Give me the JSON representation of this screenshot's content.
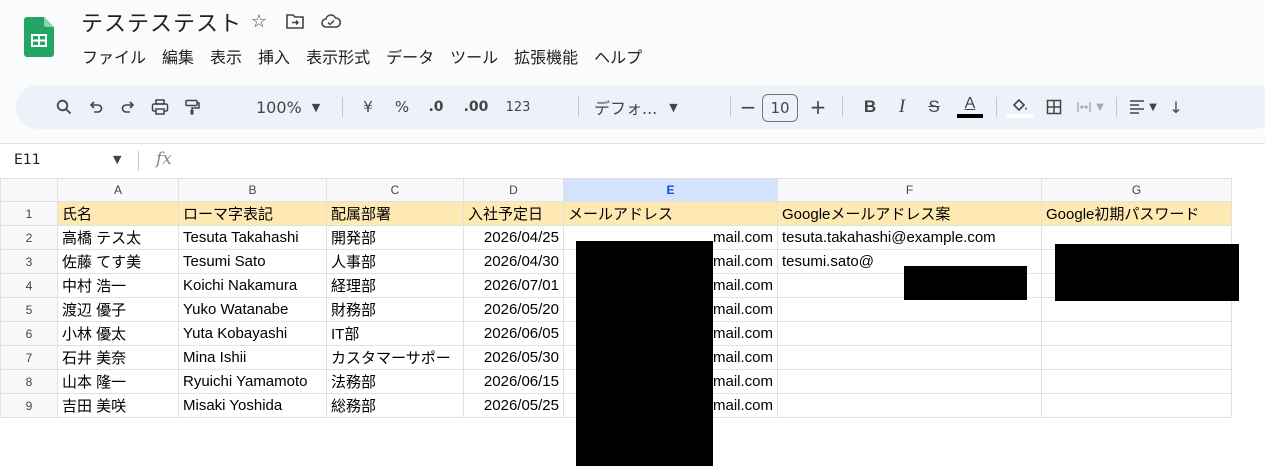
{
  "app": {
    "title": "テステステスト",
    "menu": [
      "ファイル",
      "編集",
      "表示",
      "挿入",
      "表示形式",
      "データ",
      "ツール",
      "拡張機能",
      "ヘルプ"
    ]
  },
  "toolbar": {
    "zoom": "100%",
    "currency": "¥",
    "percent": "%",
    "dec_decrease": ".0",
    "dec_increase": ".00",
    "number_format": "123",
    "font": "デフォ...",
    "minus": "−",
    "font_size": "10",
    "plus": "+",
    "bold": "B",
    "italic": "I",
    "strike": "S",
    "text_color": "A"
  },
  "formula_bar": {
    "cell_ref": "E11",
    "fx": "fx"
  },
  "columns": [
    "A",
    "B",
    "C",
    "D",
    "E",
    "F",
    "G"
  ],
  "selected_column": "E",
  "rows": [
    {
      "n": "1",
      "cells": [
        "氏名",
        "ローマ字表記",
        "配属部署",
        "入社予定日",
        "メールアドレス",
        "Googleメールアドレス案",
        "Google初期パスワード"
      ]
    },
    {
      "n": "2",
      "cells": [
        "高橋 テス太",
        "Tesuta Takahashi",
        "開発部",
        "2026/04/25",
        "mail.com",
        "tesuta.takahashi@example.com",
        ""
      ]
    },
    {
      "n": "3",
      "cells": [
        "佐藤 てす美",
        "Tesumi Sato",
        "人事部",
        "2026/04/30",
        "mail.com",
        "tesumi.sato@",
        ""
      ]
    },
    {
      "n": "4",
      "cells": [
        "中村 浩一",
        "Koichi Nakamura",
        "経理部",
        "2026/07/01",
        "mail.com",
        "",
        ""
      ]
    },
    {
      "n": "5",
      "cells": [
        "渡辺 優子",
        "Yuko Watanabe",
        "財務部",
        "2026/05/20",
        "mail.com",
        "",
        ""
      ]
    },
    {
      "n": "6",
      "cells": [
        "小林 優太",
        "Yuta Kobayashi",
        "IT部",
        "2026/06/05",
        "mail.com",
        "",
        ""
      ]
    },
    {
      "n": "7",
      "cells": [
        "石井 美奈",
        "Mina Ishii",
        "カスタマーサポー",
        "2026/05/30",
        "mail.com",
        "",
        ""
      ]
    },
    {
      "n": "8",
      "cells": [
        "山本 隆一",
        "Ryuichi Yamamoto",
        "法務部",
        "2026/06/15",
        "mail.com",
        "",
        ""
      ]
    },
    {
      "n": "9",
      "cells": [
        "吉田 美咲",
        "Misaki Yoshida",
        "総務部",
        "2026/05/25",
        "mail.com",
        "",
        ""
      ]
    }
  ]
}
